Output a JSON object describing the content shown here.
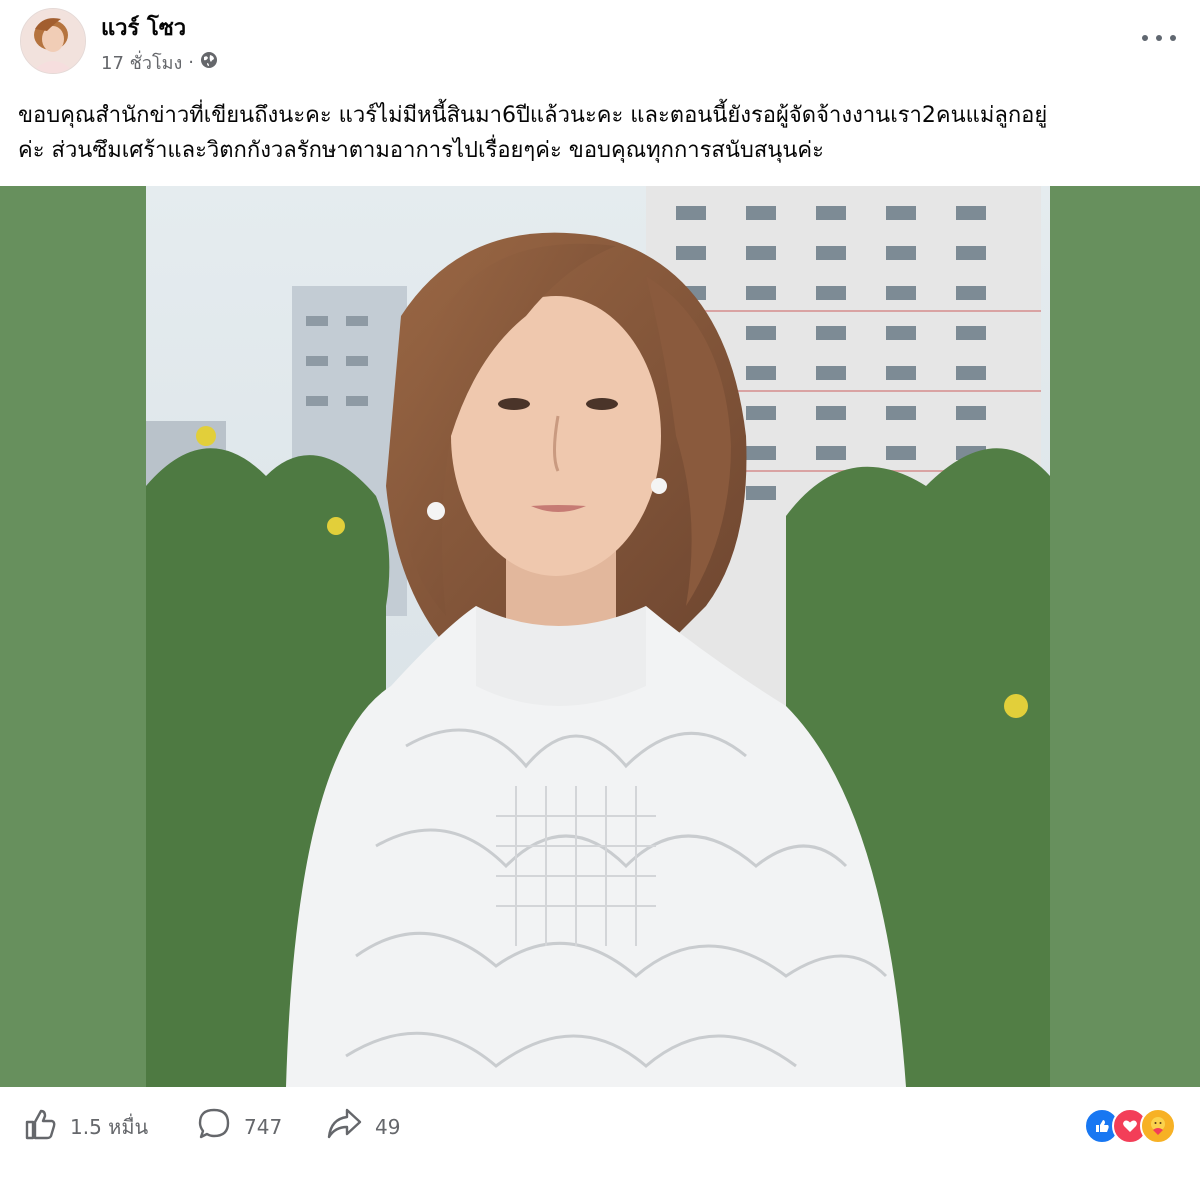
{
  "post": {
    "author_name": "แวร์ โซว",
    "timestamp": "17 ชั่วโมง",
    "separator": "·",
    "privacy_icon": "globe-icon",
    "text_line1": "ขอบคุณสำนักข่าวที่เขียนถึงนะคะ แวร์ไม่มีหนี้สินมา6ปีแล้วนะคะ และตอนนี้ยังรอผู้จัดจ้างงานเรา2คนแม่ลูกอยู่",
    "text_line2": "ค่ะ ส่วนซึมเศร้าและวิตกกังวลรักษาตามอาการไปเรื่อยๆค่ะ ขอบคุณทุกการสนับสนุนค่ะ"
  },
  "engagement": {
    "likes_count": "1.5 หมื่น",
    "comments_count": "747",
    "shares_count": "49"
  },
  "colors": {
    "photo_bg": "#67905d",
    "like_blue": "#1877f2",
    "love_red": "#f33e58",
    "care_yellow": "#f7b125",
    "secondary_text": "#65676b"
  }
}
